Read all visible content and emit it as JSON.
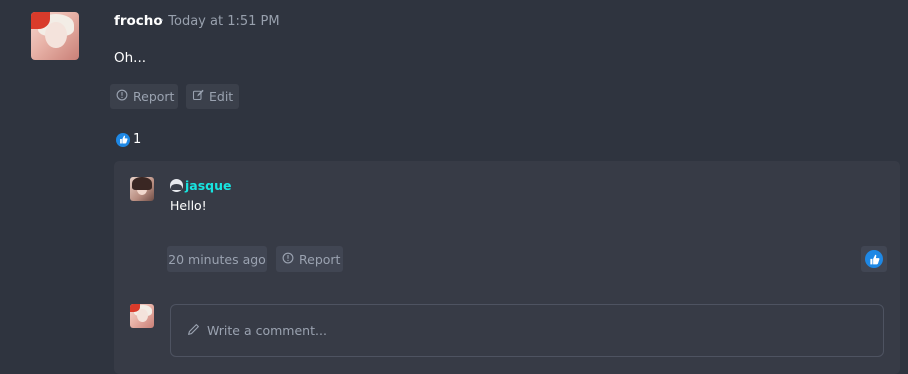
{
  "post": {
    "author": "frocho",
    "meta": "· Today at 1:51 PM",
    "content": "Oh...",
    "actions": {
      "report_label": "Report",
      "edit_label": "Edit"
    },
    "likes": {
      "count": "1"
    }
  },
  "comment": {
    "author": "jasque",
    "text": "Hello!",
    "time": "20 minutes ago",
    "report_label": "Report"
  },
  "composer": {
    "placeholder": "Write a comment..."
  },
  "colors": {
    "background": "#2f343f",
    "panel": "#373b46",
    "accent_like": "#1e88e5",
    "commenter_name": "#17e4e0"
  },
  "icons": {
    "report": "info-circle-icon",
    "edit": "edit-icon",
    "like": "thumbs-up-icon",
    "pencil": "pencil-icon",
    "badge": "user-badge-icon"
  }
}
